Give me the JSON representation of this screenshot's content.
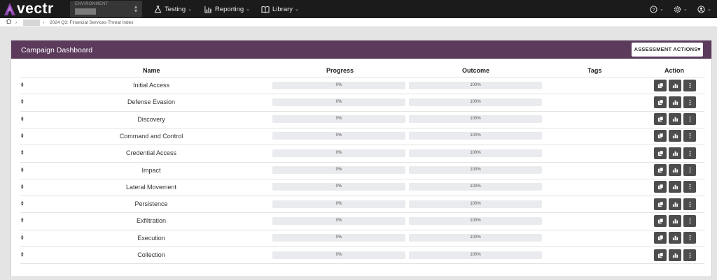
{
  "app": {
    "logo_text": "vectr"
  },
  "environment": {
    "label": "ENVIRONMENT"
  },
  "nav": {
    "testing": "Testing",
    "reporting": "Reporting",
    "library": "Library"
  },
  "breadcrumb": {
    "current": "2024 Q3: Financial Services Threat Index"
  },
  "panel": {
    "title": "Campaign Dashboard",
    "actions_button": "ASSESSMENT ACTIONS▾"
  },
  "table": {
    "headers": {
      "name": "Name",
      "progress": "Progress",
      "outcome": "Outcome",
      "tags": "Tags",
      "action": "Action"
    },
    "rows": [
      {
        "name": "Initial Access",
        "progress": "0%",
        "outcome": "100%"
      },
      {
        "name": "Defense Evasion",
        "progress": "0%",
        "outcome": "100%"
      },
      {
        "name": "Discovery",
        "progress": "0%",
        "outcome": "100%"
      },
      {
        "name": "Command and Control",
        "progress": "0%",
        "outcome": "100%"
      },
      {
        "name": "Credential Access",
        "progress": "0%",
        "outcome": "100%"
      },
      {
        "name": "Impact",
        "progress": "0%",
        "outcome": "100%"
      },
      {
        "name": "Lateral Movement",
        "progress": "0%",
        "outcome": "100%"
      },
      {
        "name": "Persistence",
        "progress": "0%",
        "outcome": "100%"
      },
      {
        "name": "Exfiltration",
        "progress": "0%",
        "outcome": "100%"
      },
      {
        "name": "Execution",
        "progress": "0%",
        "outcome": "100%"
      },
      {
        "name": "Collection",
        "progress": "0%",
        "outcome": "100%"
      }
    ]
  },
  "icons": {
    "logo": "vectr-logo-icon",
    "testing": "flask-icon",
    "reporting": "bar-chart-icon",
    "library": "book-icon",
    "help": "help-circle-icon",
    "settings": "gear-icon",
    "user": "user-circle-icon",
    "home": "home-icon",
    "sort": "sort-icon",
    "action1": "copy-icon",
    "action2": "chart-icon",
    "action3": "more-vertical-icon"
  },
  "colors": {
    "topbar": "#1b1b1b",
    "panel_header": "#5b3a5c",
    "action_button": "#4d4d4d",
    "accent": "#9b4dca"
  }
}
